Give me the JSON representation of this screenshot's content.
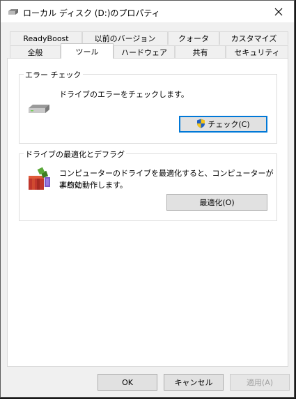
{
  "window": {
    "title": "ローカル ディスク (D:)のプロパティ"
  },
  "tabs_row1": [
    {
      "label": "ReadyBoost"
    },
    {
      "label": "以前のバージョン"
    },
    {
      "label": "クォータ"
    },
    {
      "label": "カスタマイズ"
    }
  ],
  "tabs_row2": [
    {
      "label": "全般"
    },
    {
      "label": "ツール",
      "active": true
    },
    {
      "label": "ハードウェア"
    },
    {
      "label": "共有"
    },
    {
      "label": "セキュリティ"
    }
  ],
  "error_check": {
    "title": "エラー チェック",
    "description": "ドライブのエラーをチェックします。",
    "button": "チェック(C)",
    "icon": "drive-icon"
  },
  "optimize": {
    "title": "ドライブの最適化とデフラグ",
    "description_line1": "コンピューターのドライブを最適化すると、コンピューターがより効",
    "description_line2": "率的に動作します。",
    "button": "最適化(O)",
    "icon": "defrag-icon"
  },
  "footer": {
    "ok": "OK",
    "cancel": "キャンセル",
    "apply": "適用(A)"
  },
  "colors": {
    "focus": "#0078d7",
    "window_bg": "#f0f0f0",
    "panel_bg": "#ffffff"
  }
}
